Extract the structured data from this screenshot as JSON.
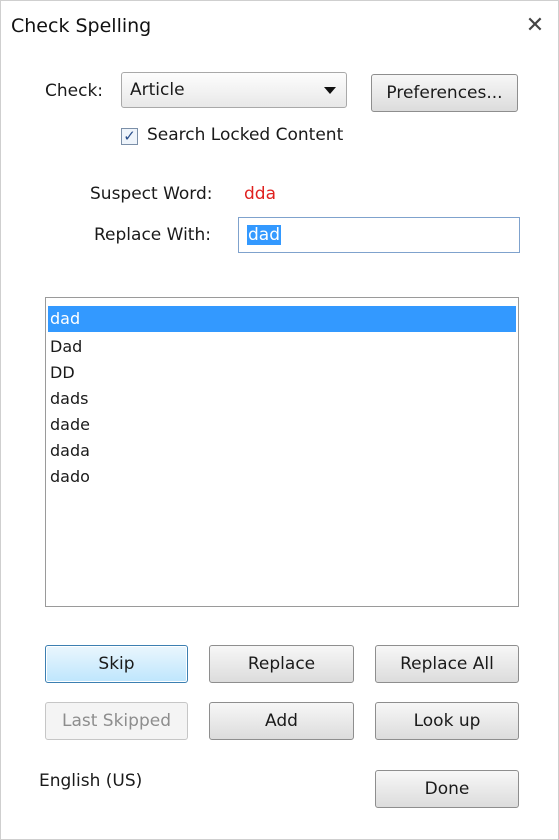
{
  "window": {
    "title": "Check Spelling",
    "close_glyph": "✕"
  },
  "check": {
    "label": "Check:",
    "selected": "Article"
  },
  "preferences_label": "Preferences...",
  "search_locked": {
    "label": "Search Locked Content",
    "checked": true
  },
  "suspect": {
    "label": "Suspect Word:",
    "value": "dda"
  },
  "replace_with": {
    "label": "Replace With:",
    "value": "dad"
  },
  "suggestions": [
    "dad",
    "Dad",
    "DD",
    "dads",
    "dade",
    "dada",
    "dado"
  ],
  "selected_suggestion_index": 0,
  "buttons": {
    "skip": "Skip",
    "replace": "Replace",
    "replace_all": "Replace All",
    "last_skipped": "Last Skipped",
    "add": "Add",
    "look_up": "Look up",
    "done": "Done"
  },
  "language": "English (US)",
  "colors": {
    "suspect": "#e0211f",
    "selection": "#3399ff"
  }
}
